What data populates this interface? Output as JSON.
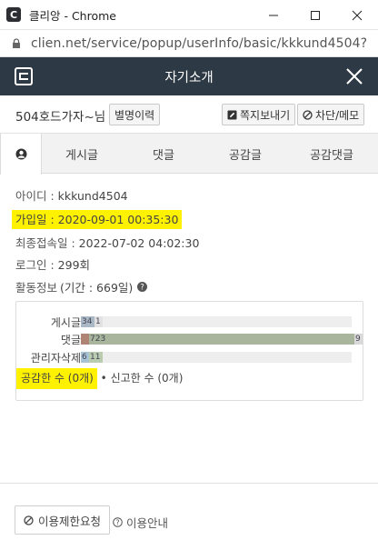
{
  "window": {
    "title": "클리앙 - Chrome",
    "app_icon": "C",
    "controls": [
      "minimize-icon",
      "maximize-icon",
      "close-icon"
    ]
  },
  "address": {
    "url": "clien.net/service/popup/userInfo/basic/kkkund4504?",
    "icon": "lock-icon"
  },
  "header": {
    "title": "자기소개",
    "logo_icon": "clien-logo-icon",
    "close_icon": "close-icon",
    "bg_color": "#2d3944"
  },
  "profile": {
    "nickname": "504호드가자~님",
    "alias_history_label": "별명이력",
    "send_message_label": "쪽지보내기",
    "block_memo_label": "차단/메모"
  },
  "tabs": [
    {
      "label": "",
      "icon": "user-icon",
      "active": true
    },
    {
      "label": "게시글",
      "active": false
    },
    {
      "label": "댓글",
      "active": false
    },
    {
      "label": "공감글",
      "active": false
    },
    {
      "label": "공감댓글",
      "active": false
    }
  ],
  "info": {
    "id_label": "아이디 : ",
    "id_value": "kkkund4504",
    "joined_label": "가입일 : ",
    "joined_value": "2020-09-01 00:35:30",
    "last_login_label": "최종접속일 : ",
    "last_login_value": "2022-07-02 04:02:30",
    "login_label": "로그인 : ",
    "login_value": "299회",
    "activity_label": "활동정보 ",
    "activity_period": "(기간 : 669일)",
    "help_icon": "help-icon",
    "highlight_color": "#fff200"
  },
  "stats": {
    "rows": [
      {
        "label": "게시글",
        "segments": [
          {
            "value": 34,
            "text": "34",
            "color": "#aab8c6"
          },
          {
            "value": 1,
            "text": "1",
            "color": "#e2e2e2"
          }
        ]
      },
      {
        "label": "댓글",
        "segments": [
          {
            "value": 6,
            "text": "",
            "color": "#b08474"
          },
          {
            "value": 723,
            "text": "723",
            "color": "#a9b59c"
          },
          {
            "value": 9,
            "text": "9",
            "color": "#d9d9d9"
          }
        ]
      },
      {
        "label": "관리자삭제",
        "segments": [
          {
            "value": 6,
            "text": "6",
            "color": "#a9c3d6"
          },
          {
            "value": 11,
            "text": "11",
            "color": "#b9ccb0"
          }
        ]
      }
    ],
    "max_total": 738,
    "liked_label": "공감한 수 (0개)",
    "separator": "•",
    "reported_label": "신고한 수 (0개)"
  },
  "footer": {
    "restrict_label": "이용제한요청",
    "restrict_icon": "ban-icon",
    "guide_label": "이용안내",
    "guide_icon": "help-circle-icon"
  }
}
